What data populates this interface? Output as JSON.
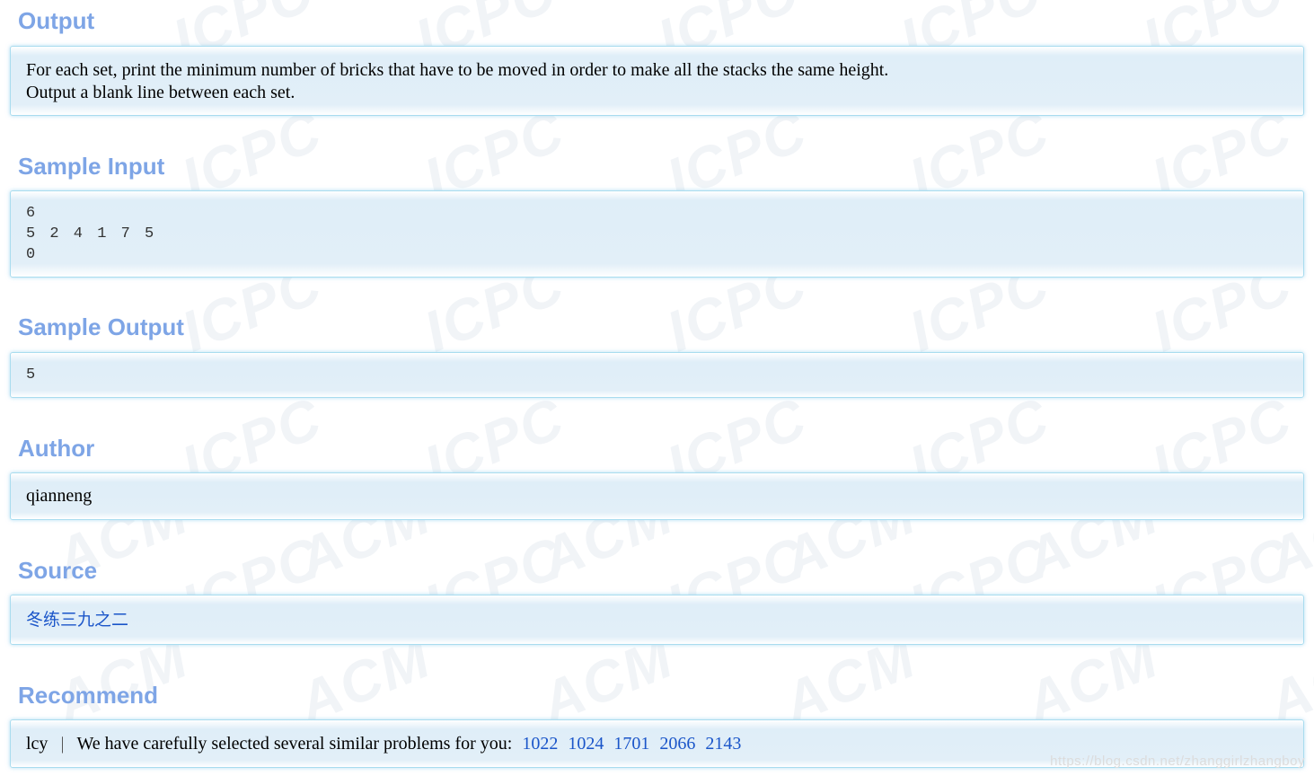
{
  "output": {
    "heading": "Output",
    "line1": "For each set, print the minimum number of bricks that have to be moved in order to make all the stacks the same height.",
    "line2": "Output a blank line between each set."
  },
  "sample_input": {
    "heading": "Sample Input",
    "lines": [
      "6",
      "5 2 4 1 7 5",
      "0"
    ]
  },
  "sample_output": {
    "heading": "Sample Output",
    "lines": [
      "5"
    ]
  },
  "author": {
    "heading": "Author",
    "name": "qianneng"
  },
  "source": {
    "heading": "Source",
    "link": "冬练三九之二"
  },
  "recommend": {
    "heading": "Recommend",
    "user": "lcy",
    "separator": "|",
    "text": "We have carefully selected several similar problems for you:",
    "problems": [
      "1022",
      "1024",
      "1701",
      "2066",
      "2143"
    ]
  },
  "watermark": {
    "text": "https://blog.csdn.net/zhanggirlzhangboy"
  },
  "colors": {
    "heading": "#7ea5e6",
    "link": "#1a55c9",
    "panel_border": "#a9dcef",
    "panel_bg": "#e2eff8"
  }
}
